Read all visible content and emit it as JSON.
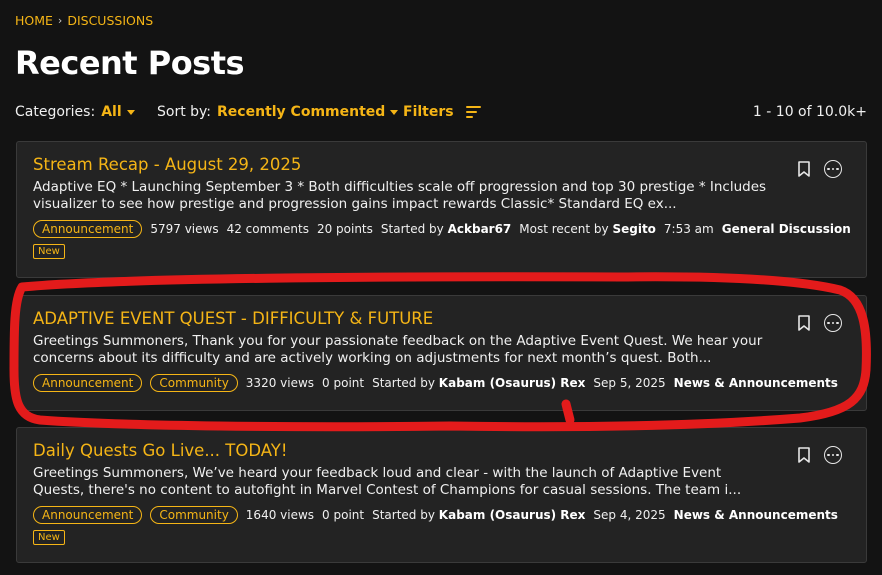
{
  "breadcrumb": {
    "home": "HOME",
    "separator": "›",
    "current": "DISCUSSIONS"
  },
  "page_title": "Recent Posts",
  "toolbar": {
    "categories_label": "Categories:",
    "categories_value": "All",
    "sort_label": "Sort by:",
    "sort_value": "Recently Commented",
    "filters_label": "Filters",
    "pager": "1 - 10 of 10.0k+"
  },
  "posts": [
    {
      "title": "Stream Recap - August 29, 2025",
      "excerpt": "Adaptive EQ * Launching September 3 * Both difficulties scale off progression and top 30 prestige * Includes visualizer to see how prestige and progression gains impact rewards Classic* Standard EQ ex...",
      "tags": [
        "Announcement"
      ],
      "views": "5797 views",
      "comments": "42 comments",
      "points": "20 points",
      "started_label": "Started by",
      "started_by": "Ackbar67",
      "recent_label": "Most recent by",
      "recent_by": "Segito",
      "time": "7:53 am",
      "category": "General Discussion",
      "badge": "New"
    },
    {
      "title": "ADAPTIVE EVENT QUEST - DIFFICULTY & FUTURE",
      "excerpt": "Greetings Summoners, Thank you for your passionate feedback on the Adaptive Event Quest. We hear your concerns about its difficulty and are actively working on adjustments for next month’s quest. Both...",
      "tags": [
        "Announcement",
        "Community"
      ],
      "views": "3320 views",
      "points": "0 point",
      "started_label": "Started by",
      "started_by": "Kabam (Osaurus) Rex",
      "time": "Sep 5, 2025",
      "category": "News & Announcements"
    },
    {
      "title": "Daily Quests Go Live... TODAY!",
      "excerpt": "Greetings Summoners, We’ve heard your feedback loud and clear - with the launch of Adaptive Event Quests, there's no content to autofight in Marvel Contest of Champions for casual sessions. The team i...",
      "tags": [
        "Announcement",
        "Community"
      ],
      "views": "1640 views",
      "points": "0 point",
      "started_label": "Started by",
      "started_by": "Kabam (Osaurus) Rex",
      "time": "Sep 4, 2025",
      "category": "News & Announcements",
      "badge": "New"
    }
  ],
  "colors": {
    "accent": "#f5b516",
    "background": "#131313",
    "card": "#232323",
    "annotation": "#e31b1b"
  },
  "icons": {
    "bookmark": "bookmark-icon",
    "more": "more-options-icon",
    "filters": "filters-icon"
  }
}
